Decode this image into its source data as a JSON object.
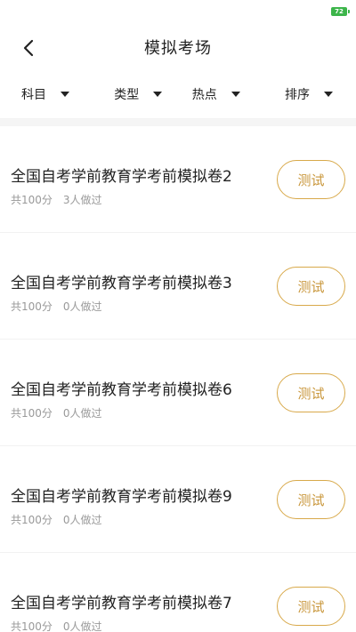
{
  "status_bar": {
    "battery_label": "72"
  },
  "header": {
    "title": "模拟考场"
  },
  "filters": [
    {
      "label": "科目"
    },
    {
      "label": "类型"
    },
    {
      "label": "热点"
    },
    {
      "label": "排序"
    }
  ],
  "exams": [
    {
      "title": "全国自考学前教育学考前模拟卷2",
      "total": "共100分",
      "done": "3人做过",
      "button": "测试"
    },
    {
      "title": "全国自考学前教育学考前模拟卷3",
      "total": "共100分",
      "done": "0人做过",
      "button": "测试"
    },
    {
      "title": "全国自考学前教育学考前模拟卷6",
      "total": "共100分",
      "done": "0人做过",
      "button": "测试"
    },
    {
      "title": "全国自考学前教育学考前模拟卷9",
      "total": "共100分",
      "done": "0人做过",
      "button": "测试"
    },
    {
      "title": "全国自考学前教育学考前模拟卷7",
      "total": "共100分",
      "done": "0人做过",
      "button": "测试"
    }
  ],
  "colors": {
    "accent": "#c9973c",
    "battery": "#3cb54a"
  }
}
